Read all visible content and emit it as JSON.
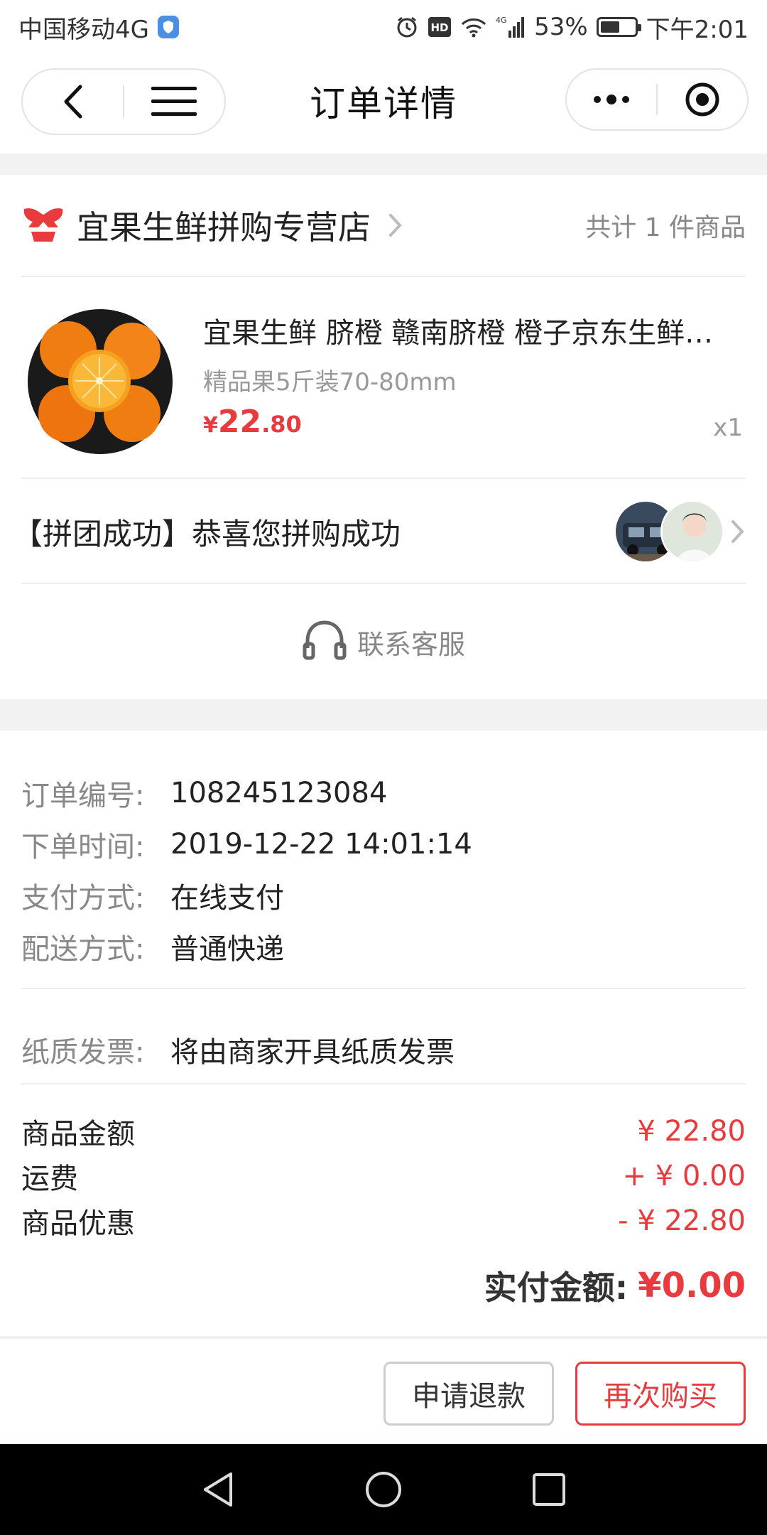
{
  "status_bar": {
    "carrier": "中国移动4G",
    "battery_percent": "53%",
    "time": "下午2:01",
    "network": "4G",
    "hd": "HD"
  },
  "nav": {
    "title": "订单详情"
  },
  "store": {
    "name": "宜果生鲜拼购专营店",
    "count_text": "共计 1 件商品"
  },
  "product": {
    "title": "宜果生鲜 脐橙 赣南脐橙 橙子京东生鲜…",
    "spec": "精品果5斤装70-80mm",
    "price_symbol": "¥",
    "price_int": "22",
    "price_dec": ".80",
    "qty": "x1"
  },
  "group": {
    "text": "【拼团成功】恭喜您拼购成功"
  },
  "service": {
    "label": "联系客服"
  },
  "order_info": {
    "order_no_label": "订单编号:",
    "order_no": "108245123084",
    "time_label": "下单时间:",
    "time": "2019-12-22 14:01:14",
    "pay_label": "支付方式:",
    "pay": "在线支付",
    "ship_label": "配送方式:",
    "ship": "普通快递",
    "invoice_label": "纸质发票:",
    "invoice": "将由商家开具纸质发票"
  },
  "amounts": {
    "goods_label": "商品金额",
    "goods": "¥ 22.80",
    "freight_label": "运费",
    "freight": "+ ¥ 0.00",
    "discount_label": "商品优惠",
    "discount": "- ¥ 22.80",
    "paid_label": "实付金额:",
    "paid": "¥0.00"
  },
  "buttons": {
    "refund": "申请退款",
    "rebuy": "再次购买"
  },
  "colors": {
    "accent_red": "#e93b3d"
  }
}
